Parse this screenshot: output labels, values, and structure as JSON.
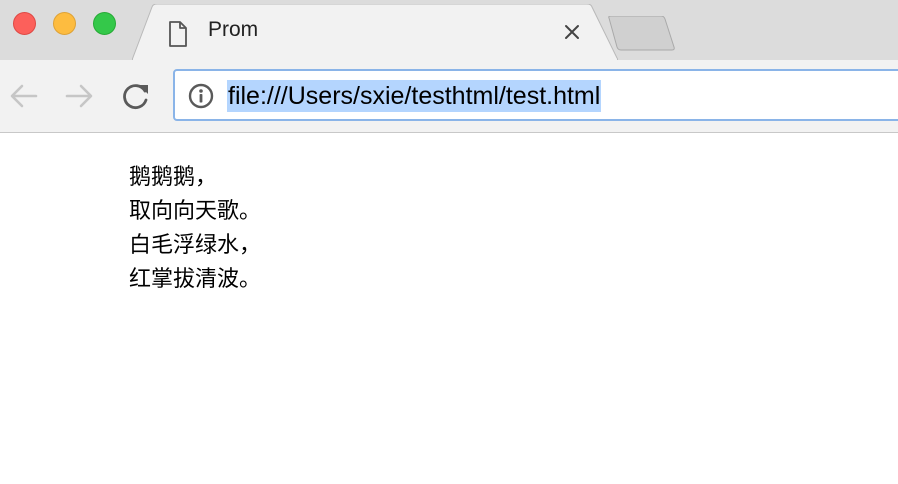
{
  "window": {
    "controls": [
      "close",
      "minimize",
      "zoom"
    ]
  },
  "tab": {
    "title": "Prom",
    "icon": "page-icon",
    "close_icon": "close-icon"
  },
  "new_tab": {
    "icon": "new-tab"
  },
  "toolbar": {
    "back_icon": "arrow-left-icon",
    "forward_icon": "arrow-right-icon",
    "reload_icon": "reload-icon",
    "back_enabled": false,
    "forward_enabled": false
  },
  "omnibox": {
    "info_icon": "info-icon",
    "url": "file:///Users/sxie/testhtml/test.html",
    "selected": true,
    "focus_color": "#8ab4e8",
    "selection_color": "#b4d5fe"
  },
  "page": {
    "lines": [
      "鹅鹅鹅，",
      "取向向天歌。",
      "白毛浮绿水，",
      "红掌拔清波。"
    ]
  }
}
